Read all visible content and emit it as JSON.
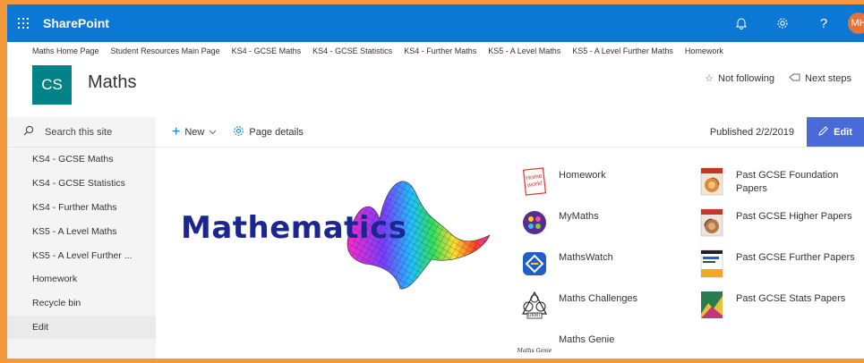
{
  "suitebar": {
    "app_name": "SharePoint",
    "avatar_initials": "MH",
    "color": "#0a78d4"
  },
  "topnav": [
    "Maths Home Page",
    "Student Resources Main Page",
    "KS4 - GCSE Maths",
    "KS4 - GCSE Statistics",
    "KS4 - Further Maths",
    "KS5 - A Level Maths",
    "KS5 - A Level Further Maths",
    "Homework"
  ],
  "site": {
    "logo_text": "CS",
    "title": "Maths",
    "not_following": "Not following",
    "next_steps": "Next steps",
    "logo_color": "#038387"
  },
  "leftnav": {
    "search_placeholder": "Search this site",
    "items": [
      "KS4 - GCSE Maths",
      "KS4 - GCSE Statistics",
      "KS4 - Further Maths",
      "KS5 - A Level Maths",
      "KS5 - A Level Further ...",
      "Homework",
      "Recycle bin",
      "Edit"
    ]
  },
  "commandbar": {
    "new_label": "New",
    "page_details_label": "Page details",
    "published": "Published 2/2/2019",
    "edit_label": "Edit",
    "edit_color": "#4a6ad8"
  },
  "hero": {
    "word": "Mathematics"
  },
  "quicklinks": {
    "col1": [
      "Homework",
      "MyMaths",
      "MathsWatch",
      "Maths Challenges",
      "Maths Genie"
    ],
    "col2": [
      "Past GCSE Foundation Papers",
      "Past GCSE Higher Papers",
      "Past GCSE Further Papers",
      "Past GCSE Stats Papers"
    ],
    "icon_text": {
      "homework": "Home work!",
      "ukmt": "UKMT",
      "genie": "Maths Genie"
    }
  }
}
